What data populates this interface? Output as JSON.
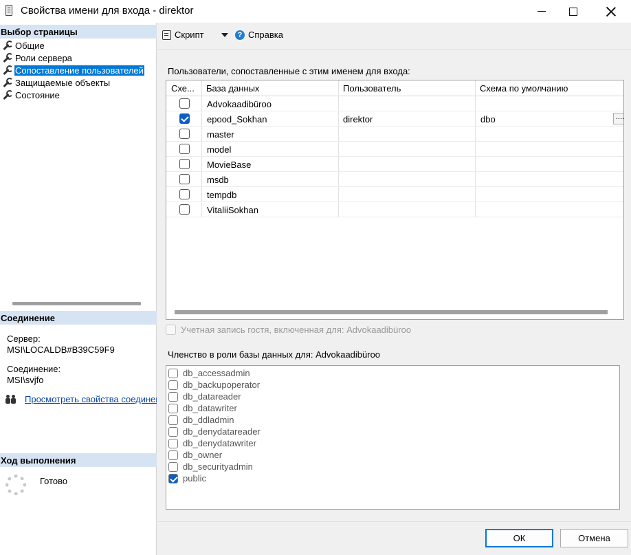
{
  "window": {
    "title": "Свойства имени для входа - direktor"
  },
  "left_panel": {
    "pages_header": "Выбор страницы",
    "pages": [
      {
        "label": "Общие",
        "selected": false
      },
      {
        "label": "Роли сервера",
        "selected": false
      },
      {
        "label": "Сопоставление пользователей",
        "selected": true
      },
      {
        "label": "Защищаемые объекты",
        "selected": false
      },
      {
        "label": "Состояние",
        "selected": false
      }
    ],
    "connection_header": "Соединение",
    "server_label": "Сервер:",
    "server_value": "MSI\\LOCALDB#B39C59F9",
    "connection_label": "Соединение:",
    "connection_value": "MSI\\svjfo",
    "view_properties_link": "Просмотреть свойства соединения",
    "progress_header": "Ход выполнения",
    "progress_status": "Готово"
  },
  "toolbar": {
    "script_label": "Скрипт",
    "help_label": "Справка"
  },
  "users_grid": {
    "caption": "Пользователи, сопоставленные с этим именем для входа:",
    "columns": [
      "Схе...",
      "База данных",
      "Пользователь",
      "Схема по умолчанию"
    ],
    "rows": [
      {
        "checked": false,
        "database": "Advokaadibüroo",
        "user": "",
        "schema": ""
      },
      {
        "checked": true,
        "database": "epood_Sokhan",
        "user": "direktor",
        "schema": "dbo"
      },
      {
        "checked": false,
        "database": "master",
        "user": "",
        "schema": ""
      },
      {
        "checked": false,
        "database": "model",
        "user": "",
        "schema": ""
      },
      {
        "checked": false,
        "database": "MovieBase",
        "user": "",
        "schema": ""
      },
      {
        "checked": false,
        "database": "msdb",
        "user": "",
        "schema": ""
      },
      {
        "checked": false,
        "database": "tempdb",
        "user": "",
        "schema": ""
      },
      {
        "checked": false,
        "database": "VitaliiSokhan",
        "user": "",
        "schema": ""
      }
    ],
    "ellipsis_label": "...."
  },
  "guest_account": {
    "label": "Учетная запись гостя, включенная для: Advokaadibüroo",
    "checked": false,
    "enabled": false
  },
  "roles": {
    "caption": "Членство в роли базы данных для: Advokaadibüroo",
    "items": [
      {
        "label": "db_accessadmin",
        "checked": false
      },
      {
        "label": "db_backupoperator",
        "checked": false
      },
      {
        "label": "db_datareader",
        "checked": false
      },
      {
        "label": "db_datawriter",
        "checked": false
      },
      {
        "label": "db_ddladmin",
        "checked": false
      },
      {
        "label": "db_denydatareader",
        "checked": false
      },
      {
        "label": "db_denydatawriter",
        "checked": false
      },
      {
        "label": "db_owner",
        "checked": false
      },
      {
        "label": "db_securityadmin",
        "checked": false
      },
      {
        "label": "public",
        "checked": true
      }
    ]
  },
  "buttons": {
    "ok_label": "ОК",
    "cancel_label": "Отмена"
  },
  "colors": {
    "accent": "#0078d7",
    "section_header_bg": "#d6e3f2",
    "link": "#0645ad"
  }
}
